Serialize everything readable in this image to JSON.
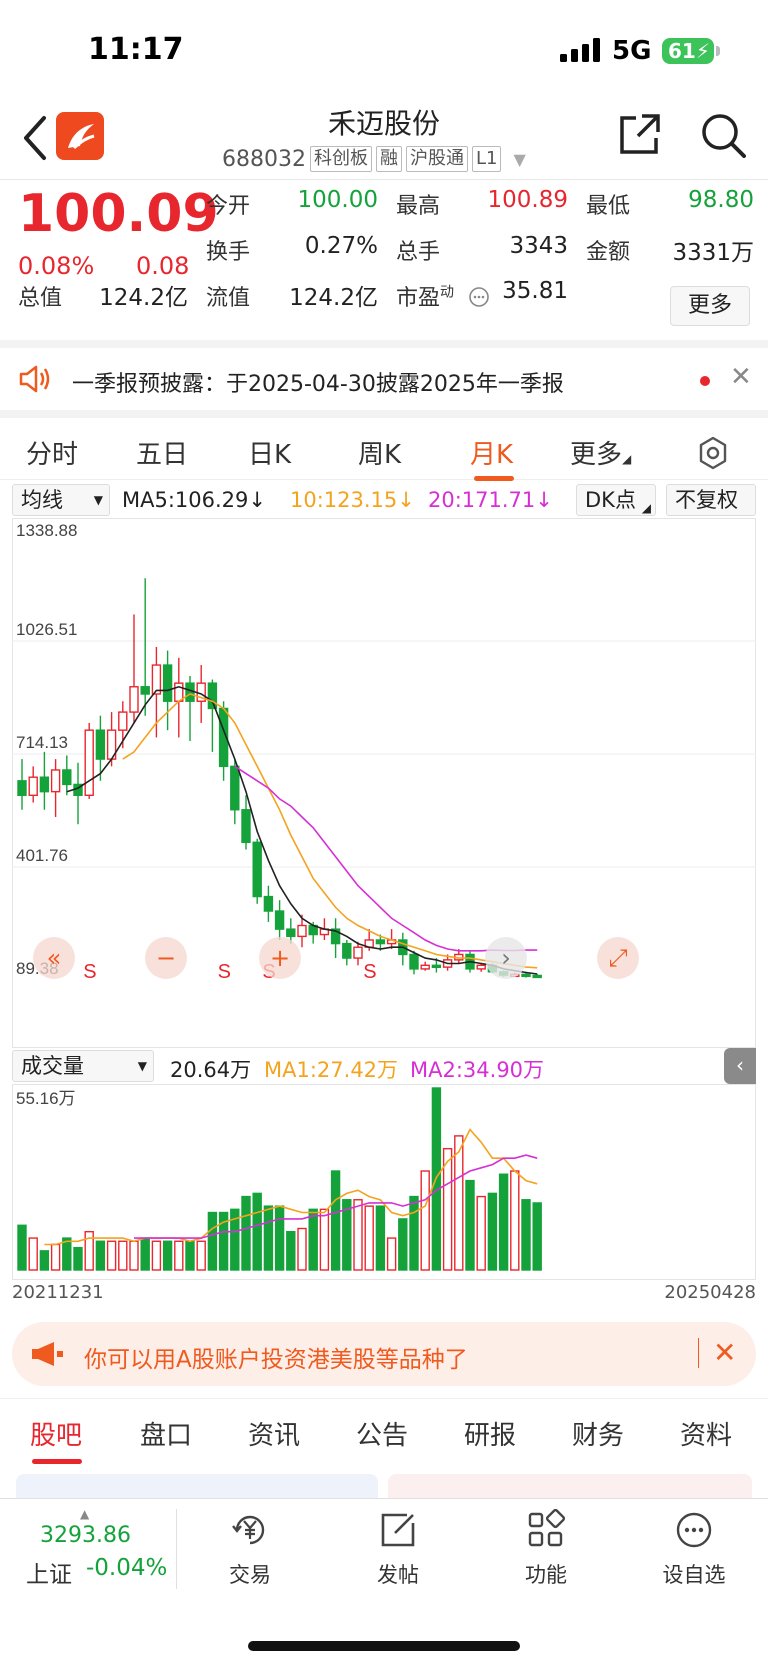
{
  "status": {
    "time": "11:17",
    "network": "5G",
    "battery": "61"
  },
  "header": {
    "title": "禾迈股份",
    "code": "688032",
    "tags": [
      "科创板",
      "融",
      "沪股通",
      "L1"
    ]
  },
  "quote": {
    "price": "100.09",
    "change_pct": "0.08%",
    "change": "0.08",
    "open_label": "今开",
    "open": "100.00",
    "high_label": "最高",
    "high": "100.89",
    "low_label": "最低",
    "low": "98.80",
    "turnover_label": "换手",
    "turnover": "0.27%",
    "vol_label": "总手",
    "vol": "3343",
    "amount_label": "金额",
    "amount": "3331万",
    "cap_label": "总值",
    "cap": "124.2亿",
    "float_label": "流值",
    "float": "124.2亿",
    "pe_label": "市盈",
    "pe_sup": "动",
    "pe": "35.81",
    "more": "更多"
  },
  "notice": {
    "text": "一季报预披露：于2025-04-30披露2025年一季报"
  },
  "period_tabs": [
    "分时",
    "五日",
    "日K",
    "周K",
    "月K",
    "更多"
  ],
  "active_period": "月K",
  "ma_bar": {
    "selector": "均线",
    "ma5": "MA5:106.29↓",
    "ma10": "10:123.15↓",
    "ma20": "20:171.71↓",
    "dk": "DK点",
    "fq": "不复权"
  },
  "vol_bar": {
    "selector": "成交量",
    "vol": "20.64万",
    "ma1": "MA1:27.42万",
    "ma2": "MA2:34.90万"
  },
  "chart_data": [
    {
      "type": "candlestick",
      "period": "monthly",
      "y_labels": [
        "1338.88",
        "1026.51",
        "714.13",
        "401.76",
        "89.38"
      ],
      "ylim": [
        89.38,
        1338.88
      ],
      "start_date": "20211231",
      "end_date": "20250428",
      "colors": {
        "up": "#e8262e",
        "down": "#15a23b",
        "ma5": "#222222",
        "ma10": "#f4a31f",
        "ma20": "#d62fd6"
      },
      "candles": [
        [
          640,
          600,
          700,
          560
        ],
        [
          600,
          650,
          680,
          580
        ],
        [
          650,
          610,
          720,
          560
        ],
        [
          610,
          670,
          700,
          540
        ],
        [
          670,
          630,
          710,
          600
        ],
        [
          630,
          600,
          690,
          520
        ],
        [
          600,
          780,
          800,
          590
        ],
        [
          780,
          700,
          820,
          640
        ],
        [
          700,
          780,
          830,
          680
        ],
        [
          780,
          830,
          860,
          730
        ],
        [
          830,
          900,
          1100,
          800
        ],
        [
          900,
          880,
          1200,
          820
        ],
        [
          880,
          960,
          1010,
          760
        ],
        [
          960,
          860,
          1000,
          780
        ],
        [
          860,
          910,
          980,
          760
        ],
        [
          910,
          860,
          930,
          750
        ],
        [
          860,
          910,
          960,
          800
        ],
        [
          910,
          840,
          920,
          720
        ],
        [
          840,
          680,
          860,
          640
        ],
        [
          680,
          560,
          700,
          520
        ],
        [
          560,
          470,
          600,
          450
        ],
        [
          470,
          320,
          480,
          300
        ],
        [
          320,
          280,
          350,
          250
        ],
        [
          280,
          230,
          310,
          200
        ],
        [
          230,
          210,
          260,
          190
        ],
        [
          210,
          240,
          270,
          180
        ],
        [
          240,
          215,
          250,
          190
        ],
        [
          215,
          230,
          260,
          200
        ],
        [
          230,
          190,
          260,
          150
        ],
        [
          190,
          150,
          200,
          130
        ],
        [
          150,
          180,
          195,
          130
        ],
        [
          180,
          200,
          230,
          170
        ],
        [
          200,
          190,
          215,
          170
        ],
        [
          190,
          200,
          230,
          175
        ],
        [
          200,
          160,
          220,
          130
        ],
        [
          160,
          120,
          170,
          105
        ],
        [
          120,
          130,
          140,
          115
        ],
        [
          130,
          125,
          150,
          110
        ],
        [
          125,
          145,
          160,
          115
        ],
        [
          145,
          160,
          175,
          135
        ],
        [
          160,
          120,
          170,
          110
        ],
        [
          120,
          130,
          135,
          112
        ],
        [
          130,
          112,
          135,
          108
        ],
        [
          112,
          103,
          115,
          98
        ],
        [
          103,
          105,
          110,
          98
        ],
        [
          105,
          102,
          112,
          96
        ],
        [
          102,
          100,
          106,
          95
        ]
      ],
      "ma5": [
        null,
        null,
        null,
        null,
        610,
        620,
        640,
        660,
        700,
        750,
        800,
        850,
        890,
        890,
        900,
        890,
        880,
        860,
        780,
        700,
        610,
        500,
        420,
        350,
        300,
        260,
        240,
        230,
        225,
        210,
        190,
        180,
        175,
        180,
        180,
        165,
        150,
        145,
        135,
        135,
        140,
        135,
        130,
        120,
        115,
        110,
        106
      ],
      "ma10": [
        null,
        null,
        null,
        null,
        null,
        null,
        null,
        null,
        null,
        700,
        720,
        760,
        800,
        830,
        860,
        880,
        870,
        860,
        840,
        800,
        740,
        680,
        620,
        560,
        490,
        430,
        370,
        330,
        290,
        260,
        240,
        225,
        210,
        200,
        190,
        180,
        170,
        160,
        155,
        150,
        150,
        145,
        140,
        135,
        130,
        125,
        123
      ],
      "ma20": [
        null,
        null,
        null,
        null,
        null,
        null,
        null,
        null,
        null,
        null,
        null,
        null,
        null,
        null,
        null,
        null,
        null,
        null,
        null,
        680,
        660,
        640,
        620,
        590,
        570,
        540,
        510,
        470,
        430,
        390,
        350,
        320,
        290,
        260,
        240,
        220,
        200,
        185,
        175,
        170,
        170,
        170,
        172,
        171,
        171,
        172,
        172
      ],
      "markers": [
        {
          "index": 6,
          "label": "S"
        },
        {
          "index": 18,
          "label": "S"
        },
        {
          "index": 22,
          "label": "S"
        },
        {
          "index": 31,
          "label": "S"
        }
      ]
    },
    {
      "type": "bar",
      "name": "volume",
      "y_labels": [
        "55.16万"
      ],
      "values": [
        14,
        10,
        6,
        8,
        10,
        7,
        12,
        9,
        9,
        9,
        9,
        10,
        9,
        9,
        9,
        9,
        9,
        18,
        18,
        19,
        23,
        24,
        20,
        20,
        12,
        13,
        19,
        19,
        31,
        22,
        22,
        20,
        20,
        10,
        16,
        23,
        31,
        57,
        38,
        42,
        28,
        23,
        24,
        30,
        31,
        22,
        21
      ],
      "ma1": [
        null,
        null,
        8,
        8,
        9,
        9,
        10,
        10,
        10,
        10,
        9,
        10,
        10,
        10,
        10,
        9,
        10,
        13,
        15,
        16,
        17,
        18,
        19,
        20,
        19,
        18,
        18,
        18,
        22,
        24,
        25,
        23,
        22,
        18,
        17,
        18,
        20,
        29,
        34,
        37,
        44,
        40,
        35,
        35,
        31,
        28,
        27
      ],
      "ma2": [
        null,
        null,
        null,
        null,
        null,
        null,
        null,
        null,
        null,
        null,
        10,
        10,
        10,
        10,
        10,
        10,
        10,
        11,
        12,
        12,
        13,
        14,
        15,
        16,
        16,
        16,
        17,
        17,
        18,
        19,
        20,
        21,
        21,
        21,
        20,
        21,
        22,
        25,
        27,
        29,
        31,
        32,
        33,
        35,
        35,
        36,
        35
      ]
    }
  ],
  "promo": {
    "text": "你可以用A股账户投资港美股等品种了"
  },
  "bottom_tabs": [
    "股吧",
    "盘口",
    "资讯",
    "公告",
    "研报",
    "财务",
    "资料"
  ],
  "active_bottom_tab": "股吧",
  "nav": {
    "index_value": "3293.86",
    "index_name": "上证",
    "index_change": "-0.04%",
    "items": [
      {
        "label": "交易",
        "icon": "yuan-icon"
      },
      {
        "label": "发帖",
        "icon": "edit-icon"
      },
      {
        "label": "功能",
        "icon": "grid-icon"
      },
      {
        "label": "设自选",
        "icon": "more-icon"
      }
    ]
  }
}
